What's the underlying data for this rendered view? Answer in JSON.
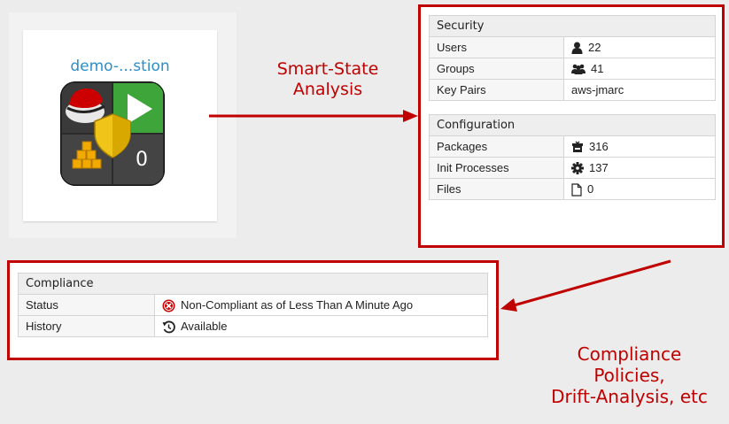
{
  "vm": {
    "name": "demo-...stion",
    "icon": "redhat-vm-quadicon",
    "state_icon": "play-icon",
    "snapshot_count": "0",
    "policy_icon": "shield-icon"
  },
  "callouts": {
    "smart_state": [
      "Smart-State",
      "Analysis"
    ],
    "compliance": [
      "Compliance",
      "Policies,",
      "Drift-Analysis, etc"
    ]
  },
  "security": {
    "title": "Security",
    "rows": [
      {
        "label": "Users",
        "icon": "user-icon",
        "value": "22"
      },
      {
        "label": "Groups",
        "icon": "group-icon",
        "value": "41"
      },
      {
        "label": "Key Pairs",
        "icon": "",
        "value": "aws-jmarc"
      }
    ]
  },
  "configuration": {
    "title": "Configuration",
    "rows": [
      {
        "label": "Packages",
        "icon": "package-icon",
        "value": "316"
      },
      {
        "label": "Init Processes",
        "icon": "gear-icon",
        "value": "137"
      },
      {
        "label": "Files",
        "icon": "file-icon",
        "value": "0"
      }
    ]
  },
  "compliance": {
    "title": "Compliance",
    "rows": [
      {
        "label": "Status",
        "icon": "error-circle-icon",
        "value": "Non-Compliant as of Less Than A Minute Ago"
      },
      {
        "label": "History",
        "icon": "history-icon",
        "value": "Available"
      }
    ]
  },
  "colors": {
    "accent_red": "#c00000",
    "link_blue": "#2b8fc7",
    "play_green": "#3ea53a",
    "error_red": "#cc0000"
  }
}
